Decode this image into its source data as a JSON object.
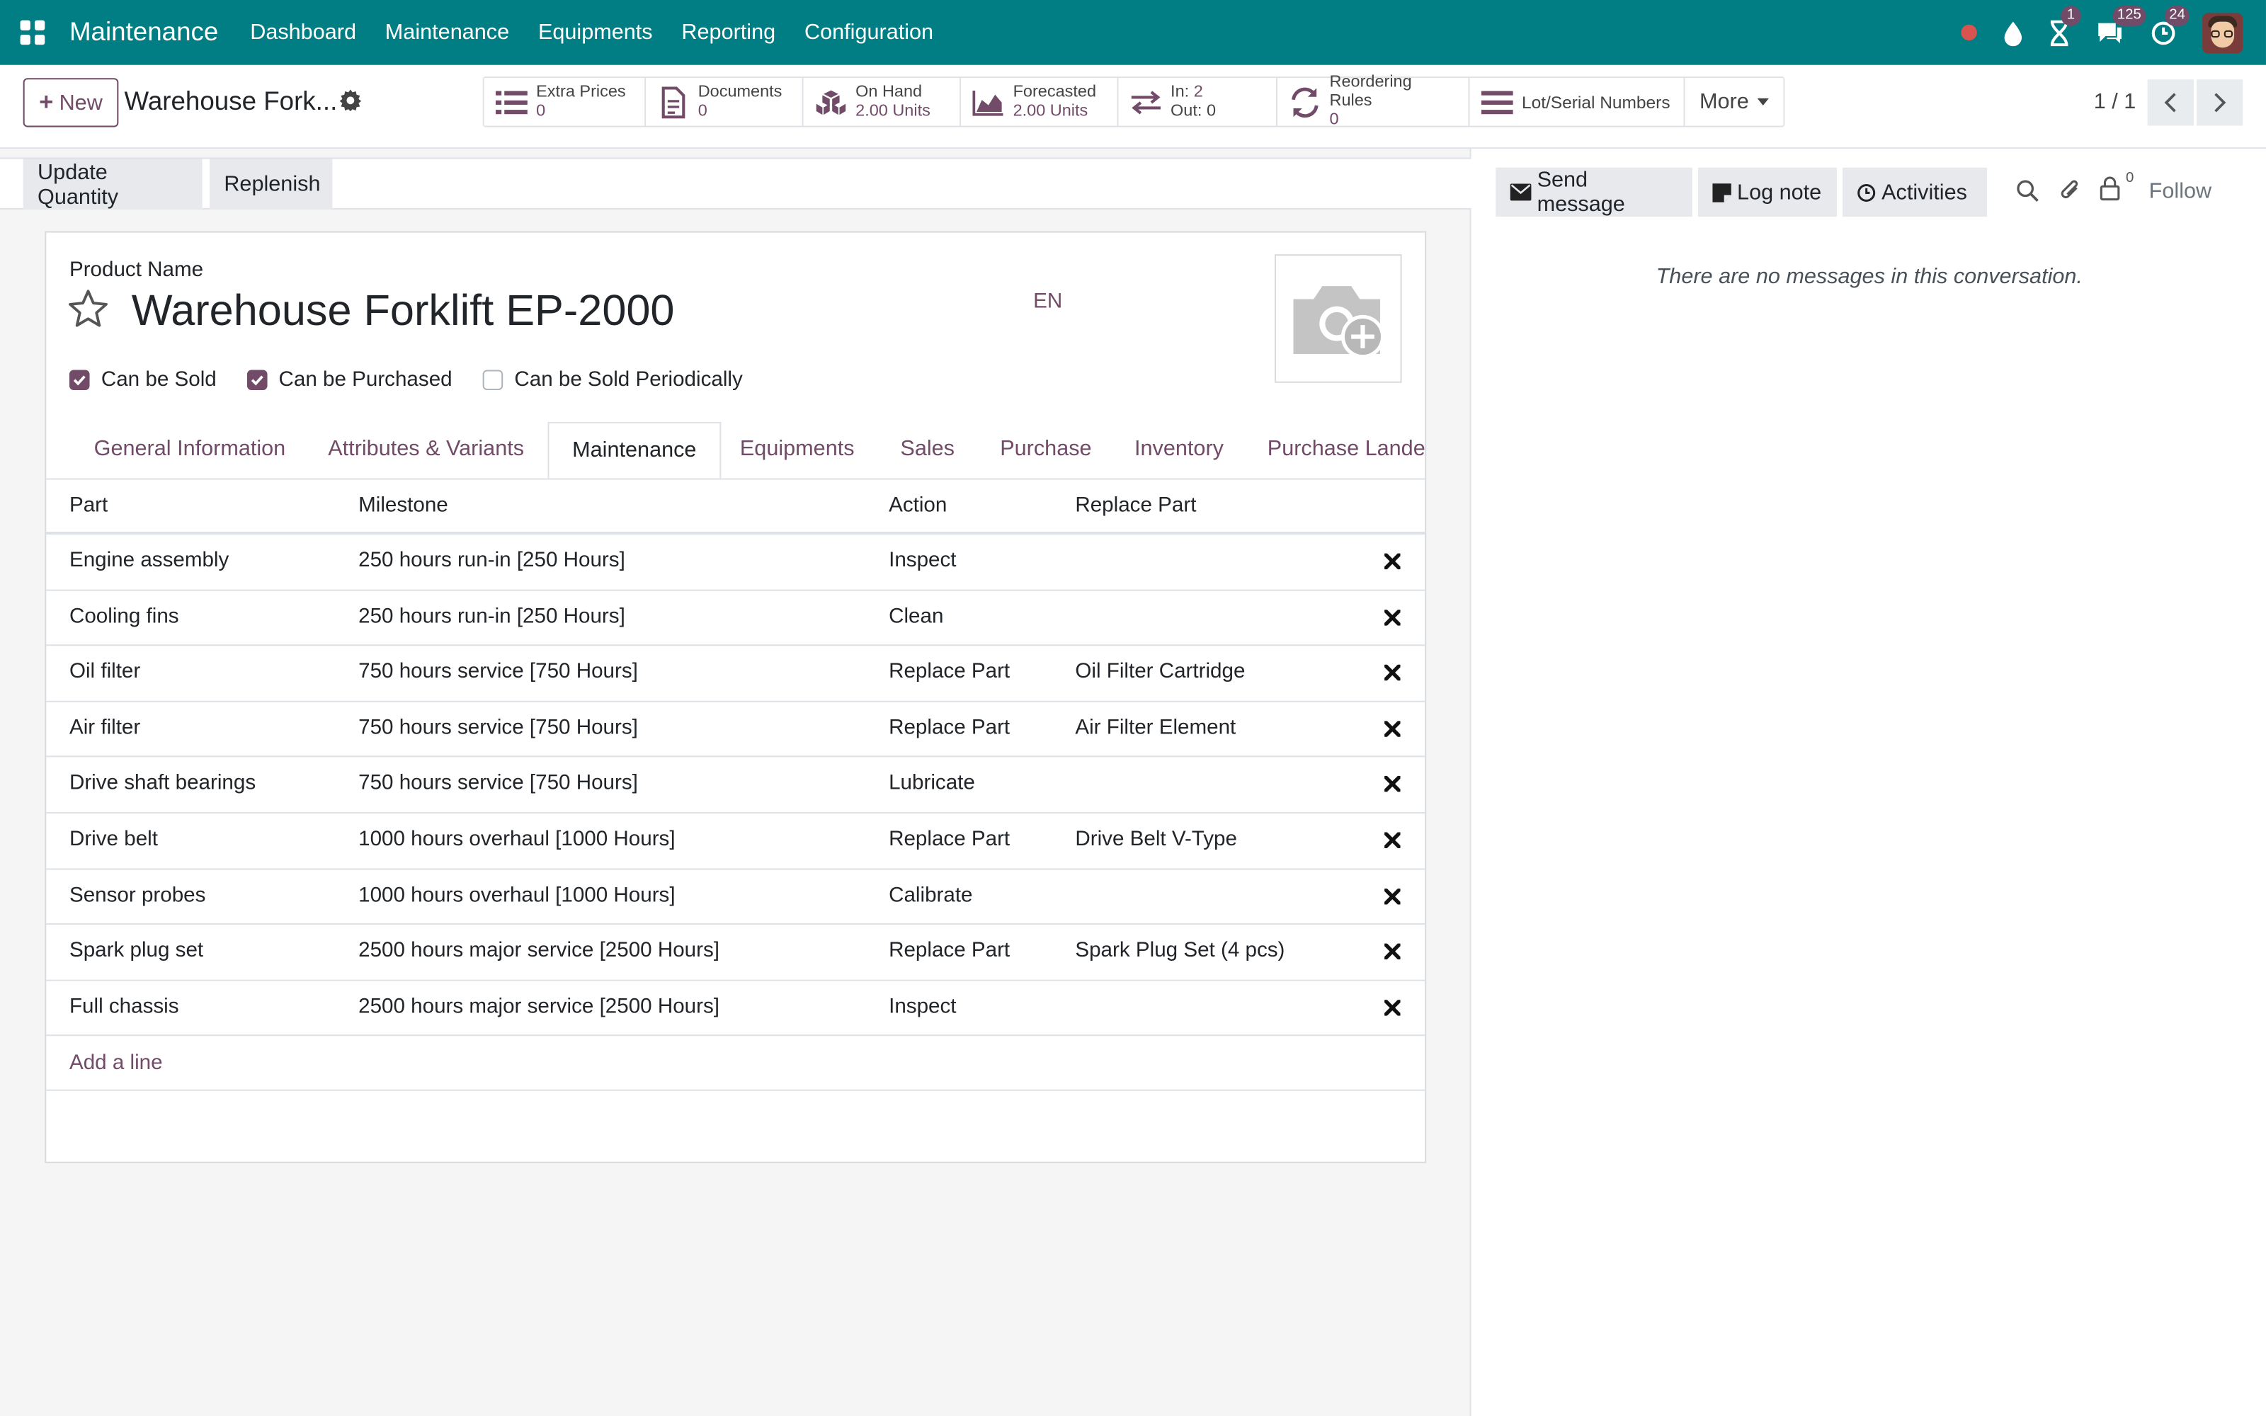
{
  "navbar": {
    "brand": "Maintenance",
    "menus": [
      "Dashboard",
      "Maintenance",
      "Equipments",
      "Reporting",
      "Configuration"
    ],
    "badges": {
      "activities": "1",
      "messages": "125",
      "clock": "24"
    }
  },
  "control_panel": {
    "new_label": "New",
    "record_title": "Warehouse Fork...",
    "smart_buttons": [
      {
        "label": "Extra Prices",
        "value": "0"
      },
      {
        "label": "Documents",
        "value": "0"
      },
      {
        "label": "On Hand",
        "value": "2.00 Units"
      },
      {
        "label": "Forecasted",
        "value": "2.00 Units"
      },
      {
        "label_in": "In:",
        "value_in": "2",
        "label_out": "Out:",
        "value_out": "0"
      },
      {
        "label": "Reordering Rules",
        "value": "0"
      },
      {
        "label": "Lot/Serial Numbers"
      }
    ],
    "more_label": "More",
    "pager": "1 / 1"
  },
  "statusbar": {
    "update_qty": "Update Quantity",
    "replenish": "Replenish"
  },
  "product": {
    "name_label": "Product Name",
    "name": "Warehouse Forklift EP-2000",
    "lang": "EN",
    "checks": [
      {
        "label": "Can be Sold",
        "checked": true
      },
      {
        "label": "Can be Purchased",
        "checked": true
      },
      {
        "label": "Can be Sold Periodically",
        "checked": false
      }
    ]
  },
  "tabs": [
    "General Information",
    "Attributes & Variants",
    "Maintenance",
    "Equipments",
    "Sales",
    "Purchase",
    "Inventory",
    "Purchase Landed Costs"
  ],
  "table": {
    "headers": [
      "Part",
      "Milestone",
      "Action",
      "Replace Part"
    ],
    "rows": [
      [
        "Engine assembly",
        "250 hours run-in [250 Hours]",
        "Inspect",
        ""
      ],
      [
        "Cooling fins",
        "250 hours run-in [250 Hours]",
        "Clean",
        ""
      ],
      [
        "Oil filter",
        "750 hours service [750 Hours]",
        "Replace Part",
        "Oil Filter Cartridge"
      ],
      [
        "Air filter",
        "750 hours service [750 Hours]",
        "Replace Part",
        "Air Filter Element"
      ],
      [
        "Drive shaft bearings",
        "750 hours service [750 Hours]",
        "Lubricate",
        ""
      ],
      [
        "Drive belt",
        "1000 hours overhaul [1000 Hours]",
        "Replace Part",
        "Drive Belt V-Type"
      ],
      [
        "Sensor probes",
        "1000 hours overhaul [1000 Hours]",
        "Calibrate",
        ""
      ],
      [
        "Spark plug set",
        "2500 hours major service [2500 Hours]",
        "Replace Part",
        "Spark Plug Set (4 pcs)"
      ],
      [
        "Full chassis",
        "2500 hours major service [2500 Hours]",
        "Inspect",
        ""
      ]
    ],
    "add_line": "Add a line"
  },
  "chatter": {
    "send_message": "Send message",
    "log_note": "Log note",
    "activities": "Activities",
    "followers_count": "0",
    "follow": "Follow",
    "empty": "There are no messages in this conversation."
  },
  "colors": {
    "navbar": "#017e84",
    "accent": "#714b67"
  }
}
